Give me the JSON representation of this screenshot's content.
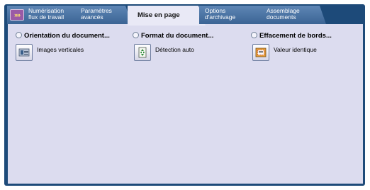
{
  "tabs": [
    {
      "line1": "Numérisation",
      "line2": "flux de travail"
    },
    {
      "line1": "Paramètres",
      "line2": "avancés"
    },
    {
      "label": "Mise en page"
    },
    {
      "line1": "Options",
      "line2": "d'archivage"
    },
    {
      "line1": "Assemblage",
      "line2": "documents"
    }
  ],
  "options": [
    {
      "title": "Orientation du document...",
      "value": "Images verticales",
      "icon": "portrait-document-icon"
    },
    {
      "title": "Format du document...",
      "value": "Détection auto",
      "icon": "auto-detect-icon"
    },
    {
      "title": "Effacement de bords...",
      "value": "Valeur identique",
      "icon": "edge-erase-icon"
    }
  ],
  "colors": {
    "frame": "#1d4a79",
    "tab": "#4a73a4",
    "active_tab": "#e9e9f6",
    "panel": "#dcdcef"
  }
}
